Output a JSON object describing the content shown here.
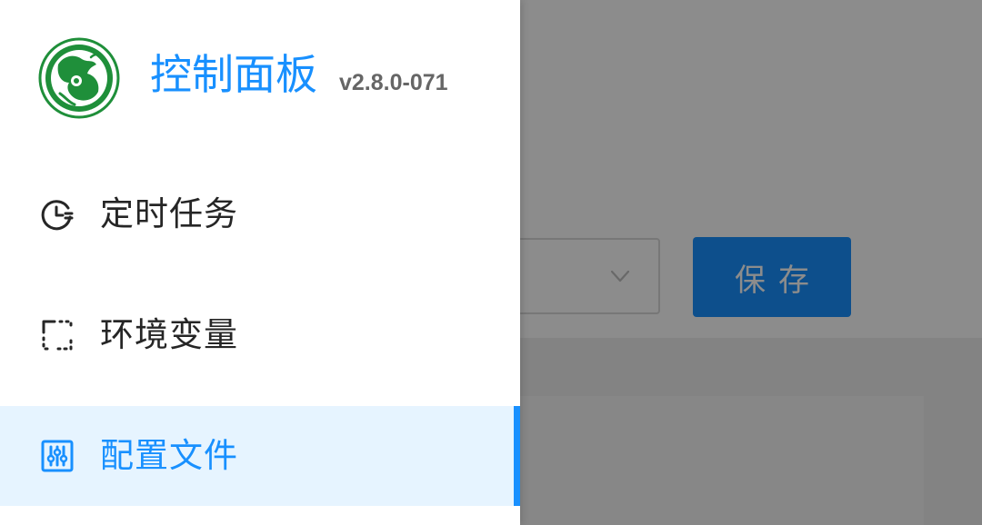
{
  "drawer": {
    "title": "控制面板",
    "version": "v2.8.0-071",
    "logo_icon": "qilin-logo-icon",
    "items": [
      {
        "label": "定时任务",
        "icon": "clock-icon",
        "active": false
      },
      {
        "label": "环境变量",
        "icon": "variable-bracket-icon",
        "active": false
      },
      {
        "label": "配置文件",
        "icon": "sliders-icon",
        "active": true
      }
    ]
  },
  "page": {
    "save_label": "保存",
    "select_icon": "chevron-down-icon"
  },
  "colors": {
    "accent": "#1890ff",
    "active_bg": "#e6f4ff",
    "logo_green": "#1f8f3a"
  }
}
